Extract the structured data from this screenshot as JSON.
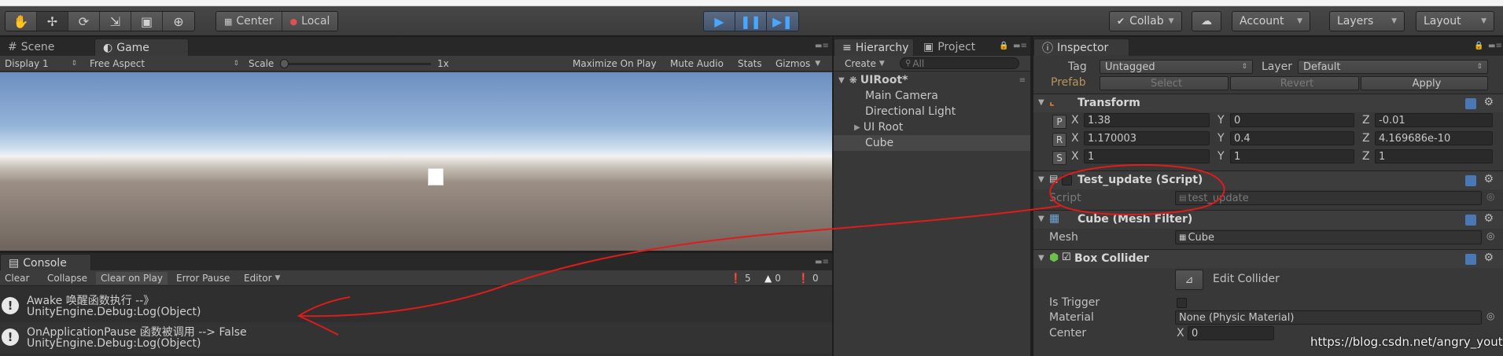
{
  "toolbar": {
    "tools": [
      "hand-tool",
      "move-tool",
      "rotate-tool",
      "scale-tool",
      "rect-tool",
      "transform-tool"
    ],
    "pivot_label": "Center",
    "space_label": "Local",
    "collab_label": "Collab",
    "account_label": "Account",
    "layers_label": "Layers",
    "layout_label": "Layout"
  },
  "scene_tabs": {
    "scene_label": "Scene",
    "game_label": "Game"
  },
  "game_bar": {
    "display": "Display 1",
    "aspect": "Free Aspect",
    "scale_label": "Scale",
    "scale_value": "1x",
    "maximize_on_play": "Maximize On Play",
    "mute_audio": "Mute Audio",
    "stats": "Stats",
    "gizmos": "Gizmos"
  },
  "console": {
    "tab_label": "Console",
    "clear": "Clear",
    "collapse": "Collapse",
    "clear_on_play": "Clear on Play",
    "error_pause": "Error Pause",
    "editor": "Editor",
    "count_info": "5",
    "count_warn": "0",
    "count_error": "0",
    "logs": [
      {
        "line1": "Awake 唤醒函数执行 --》",
        "line2": "UnityEngine.Debug:Log(Object)"
      },
      {
        "line1": "OnApplicationPause  函数被调用 --> False",
        "line2": "UnityEngine.Debug:Log(Object)"
      }
    ]
  },
  "hierarchy": {
    "tab_label": "Hierarchy",
    "project_tab_label": "Project",
    "create_label": "Create",
    "search_placeholder": "All",
    "scene_name": "UIRoot*",
    "items": [
      "Main Camera",
      "Directional Light",
      "UI Root",
      "Cube"
    ]
  },
  "inspector": {
    "tab_label": "Inspector",
    "tag_label": "Tag",
    "tag_value": "Untagged",
    "layer_label": "Layer",
    "layer_value": "Default",
    "prefab_label": "Prefab",
    "prefab_select": "Select",
    "prefab_revert": "Revert",
    "prefab_apply": "Apply",
    "transform": {
      "title": "Transform",
      "position": {
        "letter": "P",
        "x": "1.38",
        "y": "0",
        "z": "-0.01"
      },
      "rotation": {
        "letter": "R",
        "x": "1.170003",
        "y": "0.4",
        "z": "4.169686e-10"
      },
      "scale": {
        "letter": "S",
        "x": "1",
        "y": "1",
        "z": "1"
      },
      "x_label": "X",
      "y_label": "Y",
      "z_label": "Z"
    },
    "script_component": {
      "title": "Test_update (Script)",
      "script_label": "Script",
      "script_value": "test_update"
    },
    "mesh_filter": {
      "title": "Cube (Mesh Filter)",
      "mesh_label": "Mesh",
      "mesh_value": "Cube"
    },
    "box_collider": {
      "title": "Box Collider",
      "edit_collider": "Edit Collider",
      "is_trigger_label": "Is Trigger",
      "material_label": "Material",
      "material_value": "None (Physic Material)",
      "center_label": "Center",
      "center_x": "0",
      "x_label": "X"
    }
  },
  "watermark": "https://blog.csdn.net/angry_youth",
  "annotation_color": "#e01b1b"
}
